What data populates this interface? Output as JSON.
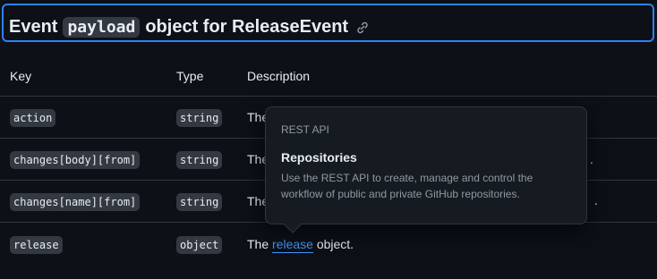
{
  "heading": {
    "prefix": "Event",
    "code": "payload",
    "suffix": "object for ReleaseEvent",
    "icon": "link-icon"
  },
  "table": {
    "headers": {
      "key": "Key",
      "type": "Type",
      "description": "Description"
    },
    "rows": [
      {
        "key": "action",
        "type": "string",
        "description": "The"
      },
      {
        "key": "changes[body][from]",
        "type": "string",
        "description": "The"
      },
      {
        "key": "changes[name][from]",
        "type": "string",
        "description": "The"
      },
      {
        "key": "release",
        "type": "object",
        "description_prefix": "The",
        "description_link": "release",
        "description_suffix": "object."
      }
    ]
  },
  "popover": {
    "eyebrow": "REST API",
    "title": "Repositories",
    "body": "Use the REST API to create, manage and control the workflow of public and private GitHub repositories."
  },
  "colors": {
    "background": "#0d1117",
    "link": "#4493f8",
    "focus_border": "#2f81f7"
  }
}
